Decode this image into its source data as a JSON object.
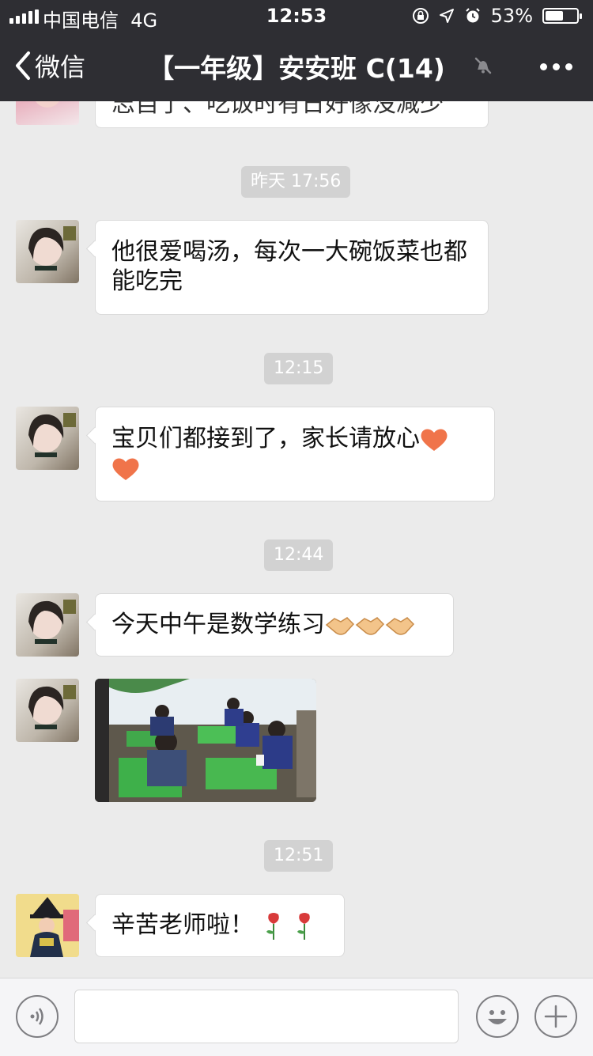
{
  "status_bar": {
    "carrier": "中国电信",
    "network": "4G",
    "time": "12:53",
    "battery_text": "53%",
    "battery_level": 0.53
  },
  "nav": {
    "back_label": "微信",
    "title": "【一年级】安安班 C(14)",
    "muted": true
  },
  "chat": {
    "cut_message": "志自了、吃饭时有日好像没减少",
    "timestamps": [
      "昨天 17:56",
      "12:15",
      "12:44",
      "12:51"
    ],
    "messages": [
      {
        "text": "他很爱喝汤，每次一大碗饭菜也都能吃完"
      },
      {
        "text": "宝贝们都接到了，家长请放心",
        "emoji": "heart"
      },
      {
        "text": "今天中午是数学练习",
        "emoji": "handshake"
      },
      {
        "type": "image",
        "description": "classroom-photo"
      },
      {
        "text": "辛苦老师啦！",
        "emoji": "rose"
      }
    ]
  },
  "colors": {
    "nav_bg": "#2e2e33",
    "chat_bg": "#ebebeb",
    "bubble_bg": "#ffffff",
    "timestamp_bg": "#d2d2d2"
  }
}
